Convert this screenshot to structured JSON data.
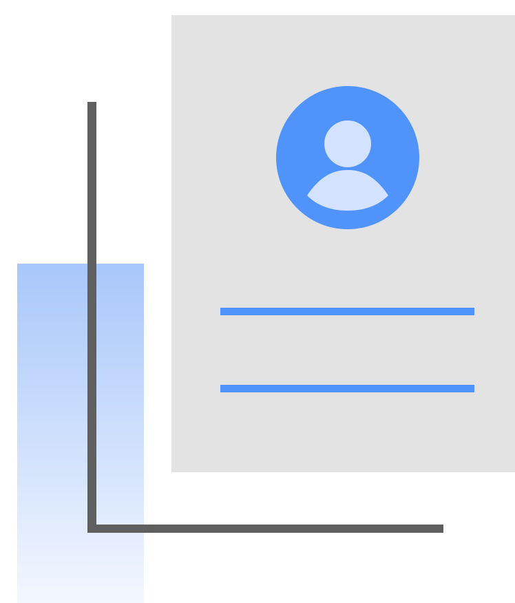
{
  "illustration": {
    "subject": "profile-document-illustration",
    "colors": {
      "background": "#ffffff",
      "card": "#e3e3e3",
      "accent": "#4f93fb",
      "avatar_figure": "#d3e3fd",
      "axis": "#5f5f5f",
      "bar_top": "#a8c7fa",
      "bar_bottom": "#f3f7fe"
    },
    "icons": [
      "person-icon"
    ],
    "elements": [
      "bar-fill",
      "axis-lines",
      "profile-card",
      "avatar",
      "text-line-1",
      "text-line-2"
    ]
  }
}
